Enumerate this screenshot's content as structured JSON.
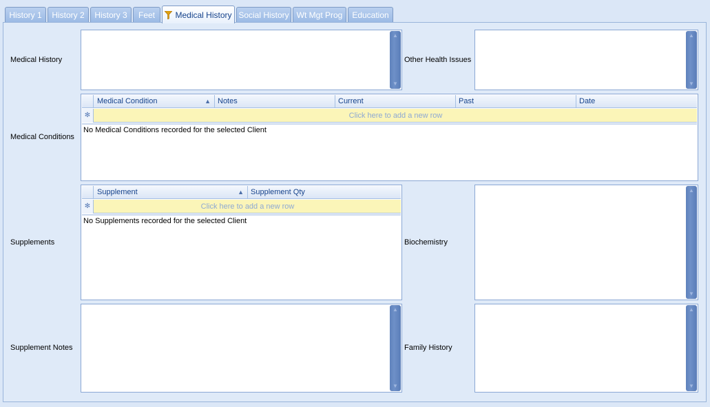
{
  "tabs": [
    {
      "label": "History 1"
    },
    {
      "label": "History 2"
    },
    {
      "label": "History 3"
    },
    {
      "label": "Feet"
    },
    {
      "label": "Medical History"
    },
    {
      "label": "Social History"
    },
    {
      "label": "Wt Mgt Prog"
    },
    {
      "label": "Education"
    }
  ],
  "active_tab": "Medical History",
  "labels": {
    "medical_history": "Medical History",
    "other_health_issues": "Other Health Issues",
    "medical_conditions": "Medical Conditions",
    "supplements": "Supplements",
    "biochemistry": "Biochemistry",
    "supplement_notes": "Supplement Notes",
    "family_history": "Family History"
  },
  "medical_conditions_grid": {
    "columns": [
      "Medical Condition",
      "Notes",
      "Current",
      "Past",
      "Date"
    ],
    "sorted_column": "Medical Condition",
    "new_row_text": "Click here to add a new row",
    "empty_message": "No Medical Conditions recorded for the selected Client"
  },
  "supplements_grid": {
    "columns": [
      "Supplement",
      "Supplement Qty"
    ],
    "sorted_column": "Supplement",
    "new_row_text": "Click here to add a new row",
    "empty_message": "No Supplements recorded for the selected Client"
  },
  "colors": {
    "background": "#dbe7f7",
    "header_text": "#15428b",
    "new_row_bg": "#fbf5b8",
    "scrollbar": "#6e90c8"
  }
}
